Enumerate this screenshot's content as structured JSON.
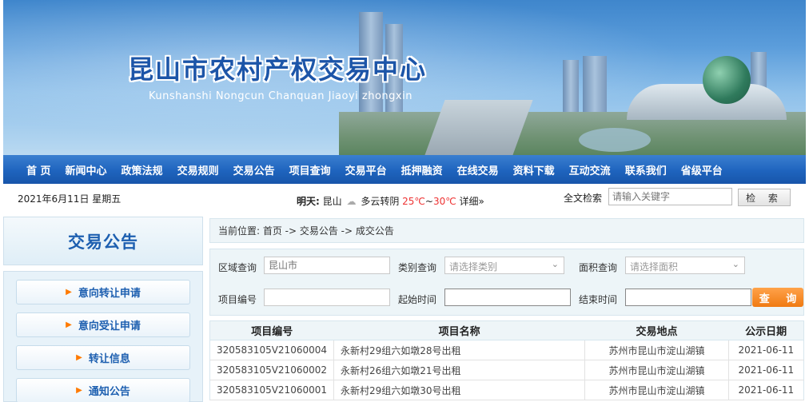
{
  "header": {
    "site_title": "昆山市农村产权交易中心",
    "site_subtitle": "Kunshanshi Nongcun Chanquan Jiaoyi zhongxin"
  },
  "nav": {
    "items": [
      "首 页",
      "新闻中心",
      "政策法规",
      "交易规则",
      "交易公告",
      "项目查询",
      "交易平台",
      "抵押融资",
      "在线交易",
      "资料下载",
      "互动交流",
      "联系我们",
      "省级平台"
    ]
  },
  "infobar": {
    "date": "2021年6月11日  星期五",
    "weather": {
      "label": "明天:",
      "city": "昆山",
      "icon": "cloud-icon",
      "condition": "多云转阴",
      "temp_high": "25℃",
      "sep": "~",
      "temp_low": "30℃",
      "detail": "详细»"
    },
    "search_label": "全文检索",
    "search_placeholder": "请输入关键字",
    "search_button": "检 索"
  },
  "sidebar": {
    "title": "交易公告",
    "items": [
      {
        "label": "意向转让申请",
        "icon": "arrow-right-icon"
      },
      {
        "label": "意向受让申请",
        "icon": "arrow-right-icon"
      },
      {
        "label": "转让信息",
        "icon": "arrow-right-icon"
      },
      {
        "label": "通知公告",
        "icon": "arrow-right-icon"
      }
    ]
  },
  "breadcrumb": "当前位置: 首页 -> 交易公告 -> 成交公告",
  "filters": {
    "region_label": "区域查询",
    "region_placeholder": "昆山市",
    "category_label": "类别查询",
    "category_placeholder": "请选择类别",
    "area_label": "面积查询",
    "area_placeholder": "请选择面积",
    "project_no_label": "项目编号",
    "start_label": "起始时间",
    "end_label": "结束时间",
    "query_button": "查 询"
  },
  "table": {
    "headers": [
      "项目编号",
      "项目名称",
      "交易地点",
      "公示日期"
    ],
    "rows": [
      [
        "320583105V21060004",
        "永新村29组六如墩28号出租",
        "苏州市昆山市淀山湖镇",
        "2021-06-11"
      ],
      [
        "320583105V21060002",
        "永新村26组六如墩21号出租",
        "苏州市昆山市淀山湖镇",
        "2021-06-11"
      ],
      [
        "320583105V21060001",
        "永新村29组六如墩30号出租",
        "苏州市昆山市淀山湖镇",
        "2021-06-11"
      ]
    ]
  },
  "colors": {
    "nav_blue": "#1f64be",
    "title_blue": "#1c55a8",
    "accent_orange": "#f07a12",
    "temp_red": "#ee3333"
  }
}
